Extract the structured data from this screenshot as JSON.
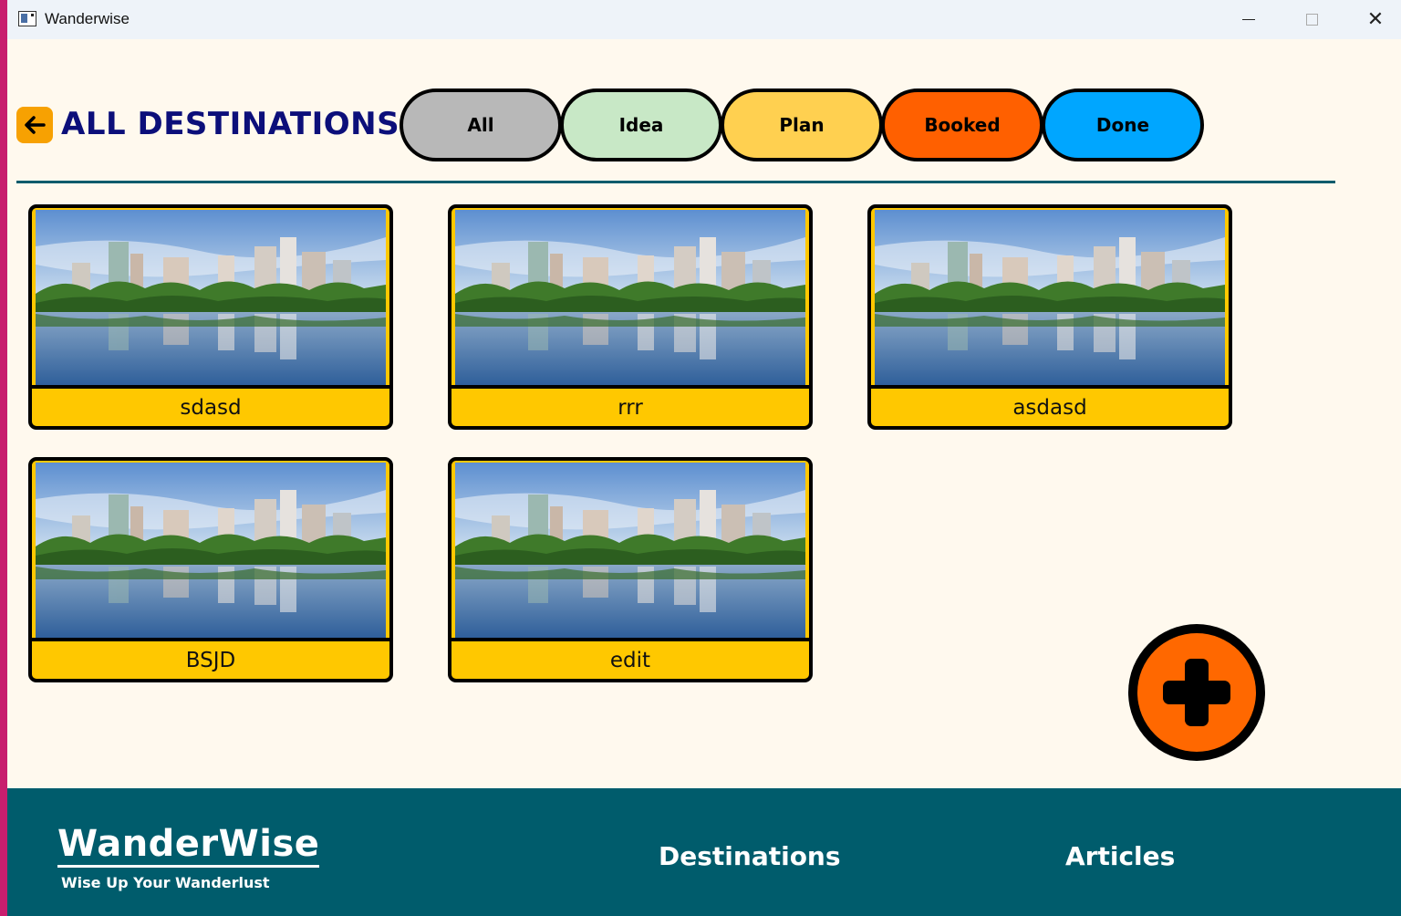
{
  "window": {
    "title": "Wanderwise",
    "controls": {
      "minimize": "minimize-icon",
      "maximize": "maximize-icon",
      "close": "✕"
    }
  },
  "header": {
    "back_icon": "arrow-left-icon",
    "title": "ALL DESTINATIONS"
  },
  "filters": [
    {
      "label": "All",
      "color": "#b8b8b8"
    },
    {
      "label": "Idea",
      "color": "#c8e8c6"
    },
    {
      "label": "Plan",
      "color": "#ffd050"
    },
    {
      "label": "Booked",
      "color": "#ff6000"
    },
    {
      "label": "Done",
      "color": "#00a6ff"
    }
  ],
  "destinations": [
    {
      "name": "sdasd",
      "image": "city-lake-skyline"
    },
    {
      "name": "rrr",
      "image": "city-lake-skyline"
    },
    {
      "name": "asdasd",
      "image": "city-lake-skyline"
    },
    {
      "name": "BSJD",
      "image": "city-lake-skyline"
    },
    {
      "name": "edit",
      "image": "city-lake-skyline"
    }
  ],
  "add_button": {
    "icon": "plus-icon",
    "color": "#ff6800"
  },
  "footer": {
    "brand": "WanderWise",
    "tagline": "Wise Up Your Wanderlust",
    "nav": [
      "Destinations",
      "Articles"
    ],
    "background": "#005c6c"
  },
  "colors": {
    "background": "#fff9ee",
    "title": "#0c0f7a",
    "card_caption": "#ffc800",
    "back_button": "#f7a102"
  }
}
